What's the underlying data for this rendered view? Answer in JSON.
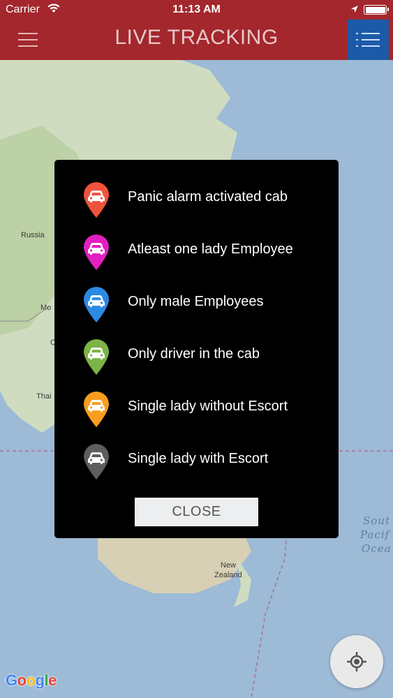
{
  "status_bar": {
    "carrier": "Carrier",
    "time": "11:13 AM"
  },
  "nav": {
    "title": "LIVE TRACKING"
  },
  "map": {
    "labels": {
      "russia": "Russia",
      "mo": "Mo",
      "c": "C",
      "thai": "Thai",
      "new_zealand_1": "New",
      "new_zealand_2": "Zealand",
      "ocean_1": "Sout",
      "ocean_2": "Pacif",
      "ocean_3": "Ocea"
    },
    "google_logo": [
      "G",
      "o",
      "o",
      "g",
      "l",
      "e"
    ]
  },
  "legend": {
    "items": [
      {
        "label": "Panic alarm activated cab",
        "color": "#f0533c",
        "icon": "car-pin-icon"
      },
      {
        "label": "Atleast one lady Employee",
        "color": "#e21fc0",
        "icon": "car-pin-icon"
      },
      {
        "label": "Only male Employees",
        "color": "#2b8ae2",
        "icon": "car-pin-icon"
      },
      {
        "label": "Only driver in the cab",
        "color": "#7db446",
        "icon": "car-pin-icon"
      },
      {
        "label": "Single lady without Escort",
        "color": "#f99d1f",
        "icon": "car-pin-icon"
      },
      {
        "label": "Single lady with Escort",
        "color": "#5e5e5e",
        "icon": "car-pin-icon"
      }
    ],
    "close_label": "CLOSE"
  },
  "colors": {
    "header": "#a3272c",
    "list_button": "#1c5aa8",
    "dialog": "#000000"
  }
}
